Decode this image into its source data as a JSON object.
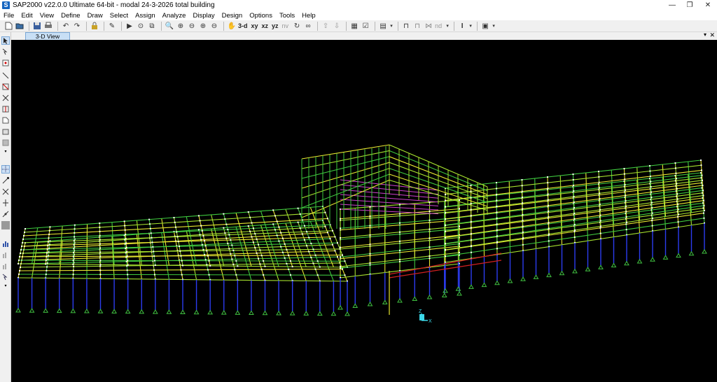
{
  "window": {
    "title": "SAP2000 v22.0.0 Ultimate 64-bit - modal 24-3-2026 total building",
    "app_icon_letter": "S",
    "minimize": "—",
    "restore": "❐",
    "close": "✕"
  },
  "menu": [
    "File",
    "Edit",
    "View",
    "Define",
    "Draw",
    "Select",
    "Assign",
    "Analyze",
    "Display",
    "Design",
    "Options",
    "Tools",
    "Help"
  ],
  "toolbar": {
    "view_3d": "3-d",
    "view_xy": "xy",
    "view_xz": "xz",
    "view_yz": "yz",
    "view_nv": "nv",
    "nd": "nd"
  },
  "tabs": {
    "active_label": "3-D View"
  },
  "axes": {
    "z": "Z",
    "x": "X"
  },
  "colors": {
    "viewport_bg": "#000000",
    "beam_yellow": "#e8e830",
    "beam_green": "#3ec83e",
    "beam_lime": "#a6e22e",
    "column_blue": "#2c3cf0",
    "beam_magenta": "#d040d0",
    "beam_red": "#d02020",
    "support_green": "#40c040",
    "axis_cyan": "#3cd8e8"
  }
}
